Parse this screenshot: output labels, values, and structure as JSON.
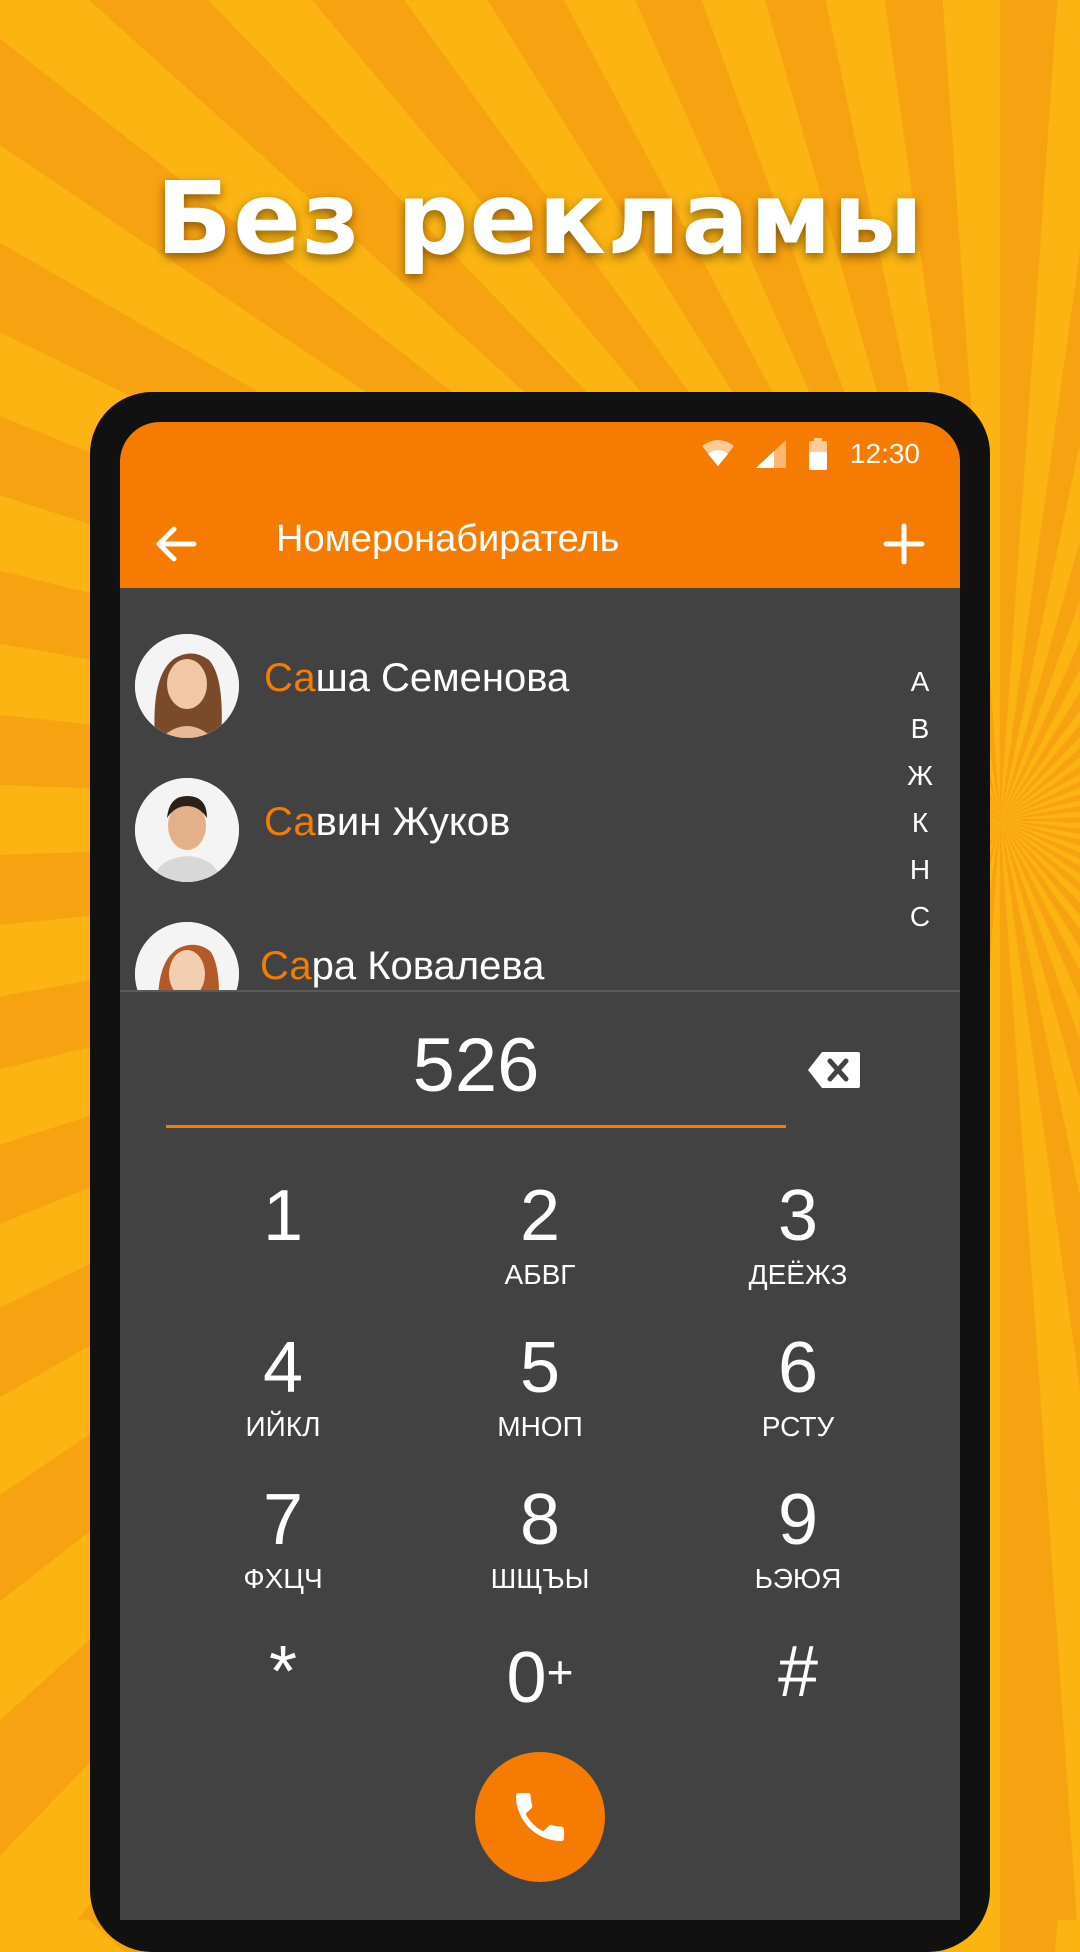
{
  "headline": "Без рекламы",
  "status": {
    "time": "12:30"
  },
  "toolbar": {
    "title": "Номеронабиратель"
  },
  "contacts": [
    {
      "match": "Са",
      "rest": "ша Семенова"
    },
    {
      "match": "Са",
      "rest": "вин Жуков"
    },
    {
      "match": "Са",
      "rest": "ра Ковалева"
    }
  ],
  "alphabet": [
    "А",
    "В",
    "Ж",
    "К",
    "Н",
    "С"
  ],
  "dialer": {
    "number": "526",
    "keys": [
      {
        "digit": "1",
        "letters": ""
      },
      {
        "digit": "2",
        "letters": "АБВГ"
      },
      {
        "digit": "3",
        "letters": "ДЕЁЖЗ"
      },
      {
        "digit": "4",
        "letters": "ИЙКЛ"
      },
      {
        "digit": "5",
        "letters": "МНОП"
      },
      {
        "digit": "6",
        "letters": "РСТУ"
      },
      {
        "digit": "7",
        "letters": "ФХЦЧ"
      },
      {
        "digit": "8",
        "letters": "ШЩЪЫ"
      },
      {
        "digit": "9",
        "letters": "ЬЭЮЯ"
      },
      {
        "digit": "*",
        "letters": ""
      },
      {
        "digit": "0",
        "letters": "",
        "plus": "+"
      },
      {
        "digit": "#",
        "letters": ""
      }
    ]
  },
  "colors": {
    "accent": "#f57c00",
    "background": "#424242"
  },
  "icons": [
    "wifi-icon",
    "signal-icon",
    "battery-icon",
    "back-arrow-icon",
    "plus-icon",
    "backspace-icon",
    "phone-icon"
  ]
}
